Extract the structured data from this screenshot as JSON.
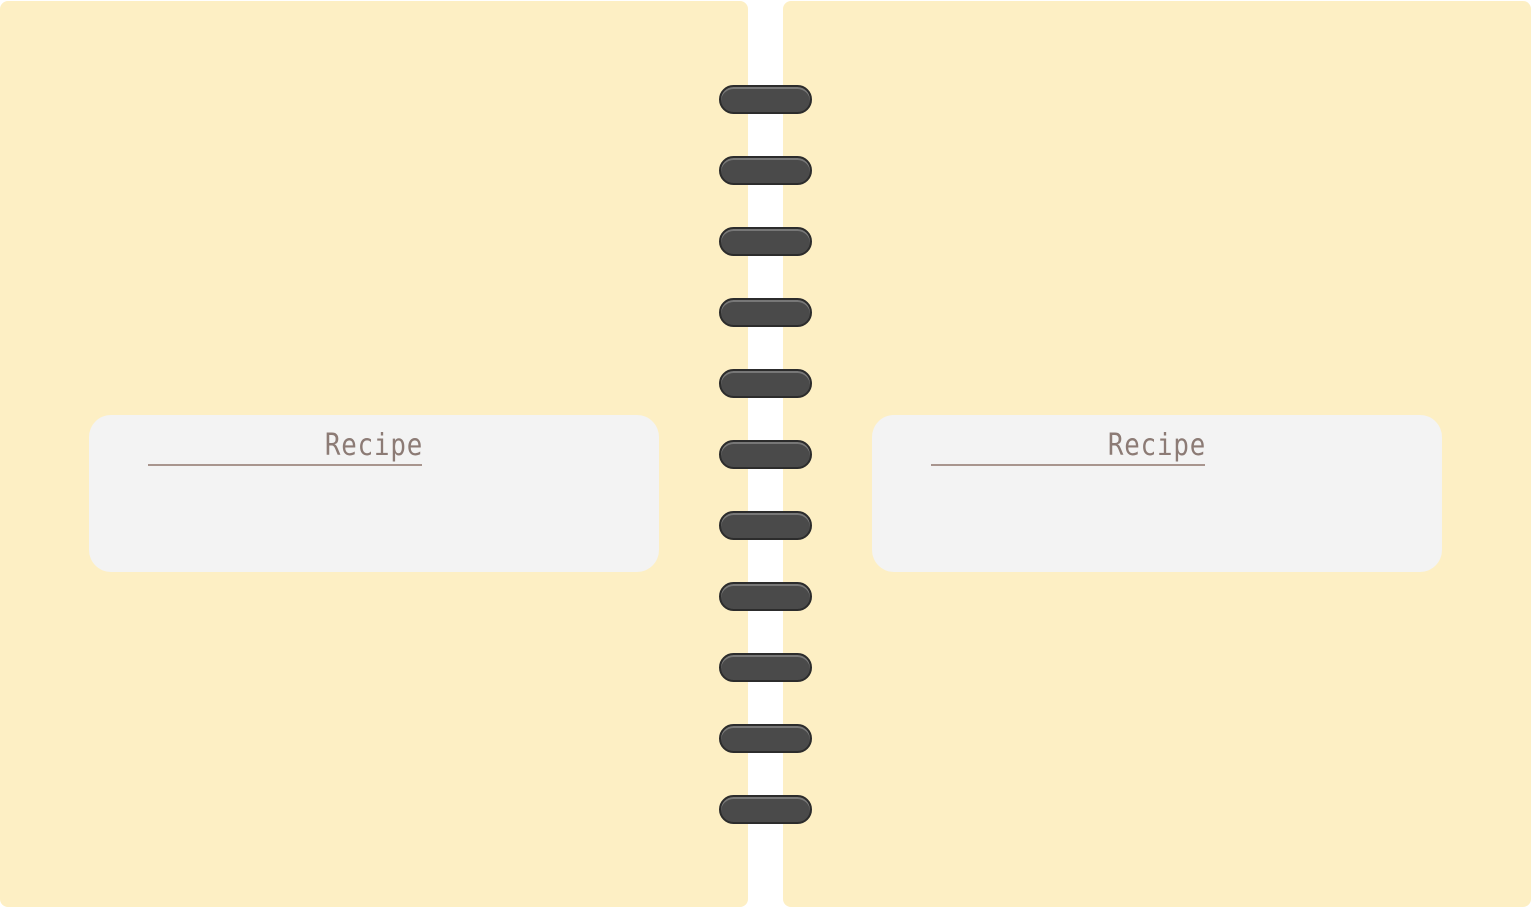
{
  "colors": {
    "background": "#ffffff",
    "page": "#fdefc4",
    "card": "#f3f3f3",
    "title_text": "#8c7b75",
    "underline": "#a8958e",
    "ring": "#4a4a4a",
    "ring_border": "#2c2c2c"
  },
  "left_page": {
    "card": {
      "title": "Recipe"
    }
  },
  "right_page": {
    "card": {
      "title": "Recipe"
    }
  },
  "binding": {
    "ring_count": 11
  }
}
